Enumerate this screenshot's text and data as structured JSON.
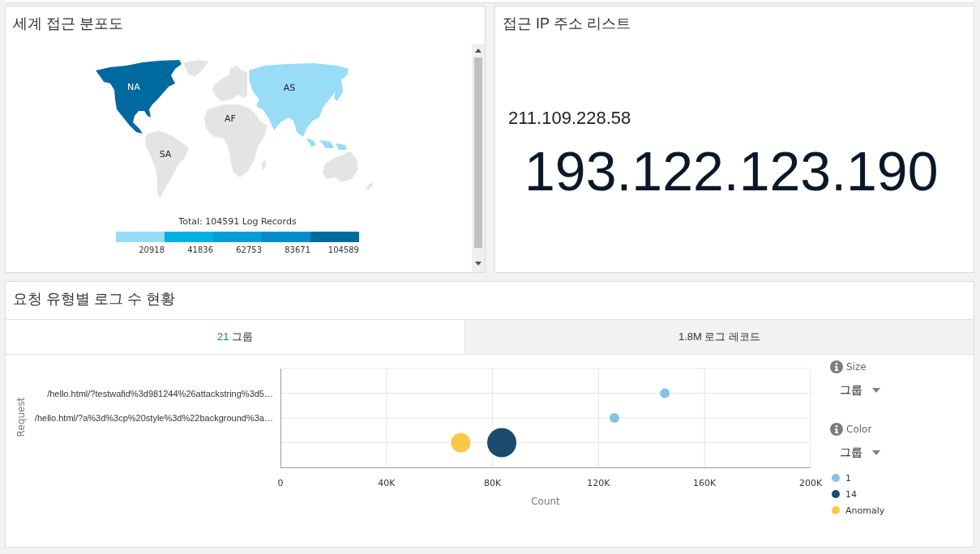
{
  "map_panel": {
    "title": "세계 접근 분포도",
    "regions": [
      {
        "kind": "northamerica",
        "label": "NA",
        "color": "#00699f"
      },
      {
        "kind": "asia",
        "label": "AS",
        "color": "#98dcf6"
      },
      {
        "kind": "africa",
        "label": "AF",
        "color": "#e4e4e4"
      },
      {
        "kind": "southamerica",
        "label": "SA",
        "color": "#e4e4e4"
      }
    ],
    "legend": {
      "title": "Total: 104591 Log Records",
      "steps": [
        {
          "color": "#98dcf6",
          "label": "20918"
        },
        {
          "color": "#00b1e1",
          "label": "41836"
        },
        {
          "color": "#00a0d7",
          "label": "62753"
        },
        {
          "color": "#008ccd",
          "label": "83671"
        },
        {
          "color": "#006ba0",
          "label": "104589"
        }
      ]
    }
  },
  "ip_panel": {
    "title": "접근 IP 주소 리스트",
    "ips": [
      {
        "kind": "small",
        "text": "211.109.228.58"
      },
      {
        "kind": "large",
        "text": "193.122.123.190"
      }
    ]
  },
  "request_panel": {
    "title": "요청 유형별 로그 수 현황",
    "tabs": [
      {
        "value": "21",
        "label": "그룹",
        "selected": true
      },
      {
        "value": "1.8M",
        "label": "로그 레코드",
        "selected": false
      }
    ],
    "chart_data": {
      "type": "scatter",
      "orientation": "horizontal",
      "grid": true,
      "xlabel": "Count",
      "ylabel": "Request",
      "categories": [
        "/hello.html/?testwafid%3d981244%26attackstring%3d5…",
        "/hello.html/?a%3d%3cp%20style%3d%22background%3a…",
        null
      ],
      "series": [
        {
          "name": "1",
          "color": "#85c1e9",
          "values": [
            145000,
            126000,
            null
          ]
        },
        {
          "name": "14",
          "color": "#1b4b6d",
          "values": [
            null,
            null,
            83500
          ]
        },
        {
          "name": "Anomaly",
          "color": "#f8c944",
          "values": [
            null,
            null,
            68000
          ]
        }
      ],
      "xlim": [
        0,
        200000
      ],
      "xticks": [
        {
          "value": 0,
          "label": "0"
        },
        {
          "value": 40000,
          "label": "40K"
        },
        {
          "value": 80000,
          "label": "80K"
        },
        {
          "value": 120000,
          "label": "120K"
        },
        {
          "value": 160000,
          "label": "160K"
        },
        {
          "value": 200000,
          "label": "200K"
        }
      ]
    },
    "controls": [
      {
        "label": "Size",
        "value": "그룹"
      },
      {
        "label": "Color",
        "value": "그룹"
      }
    ]
  }
}
